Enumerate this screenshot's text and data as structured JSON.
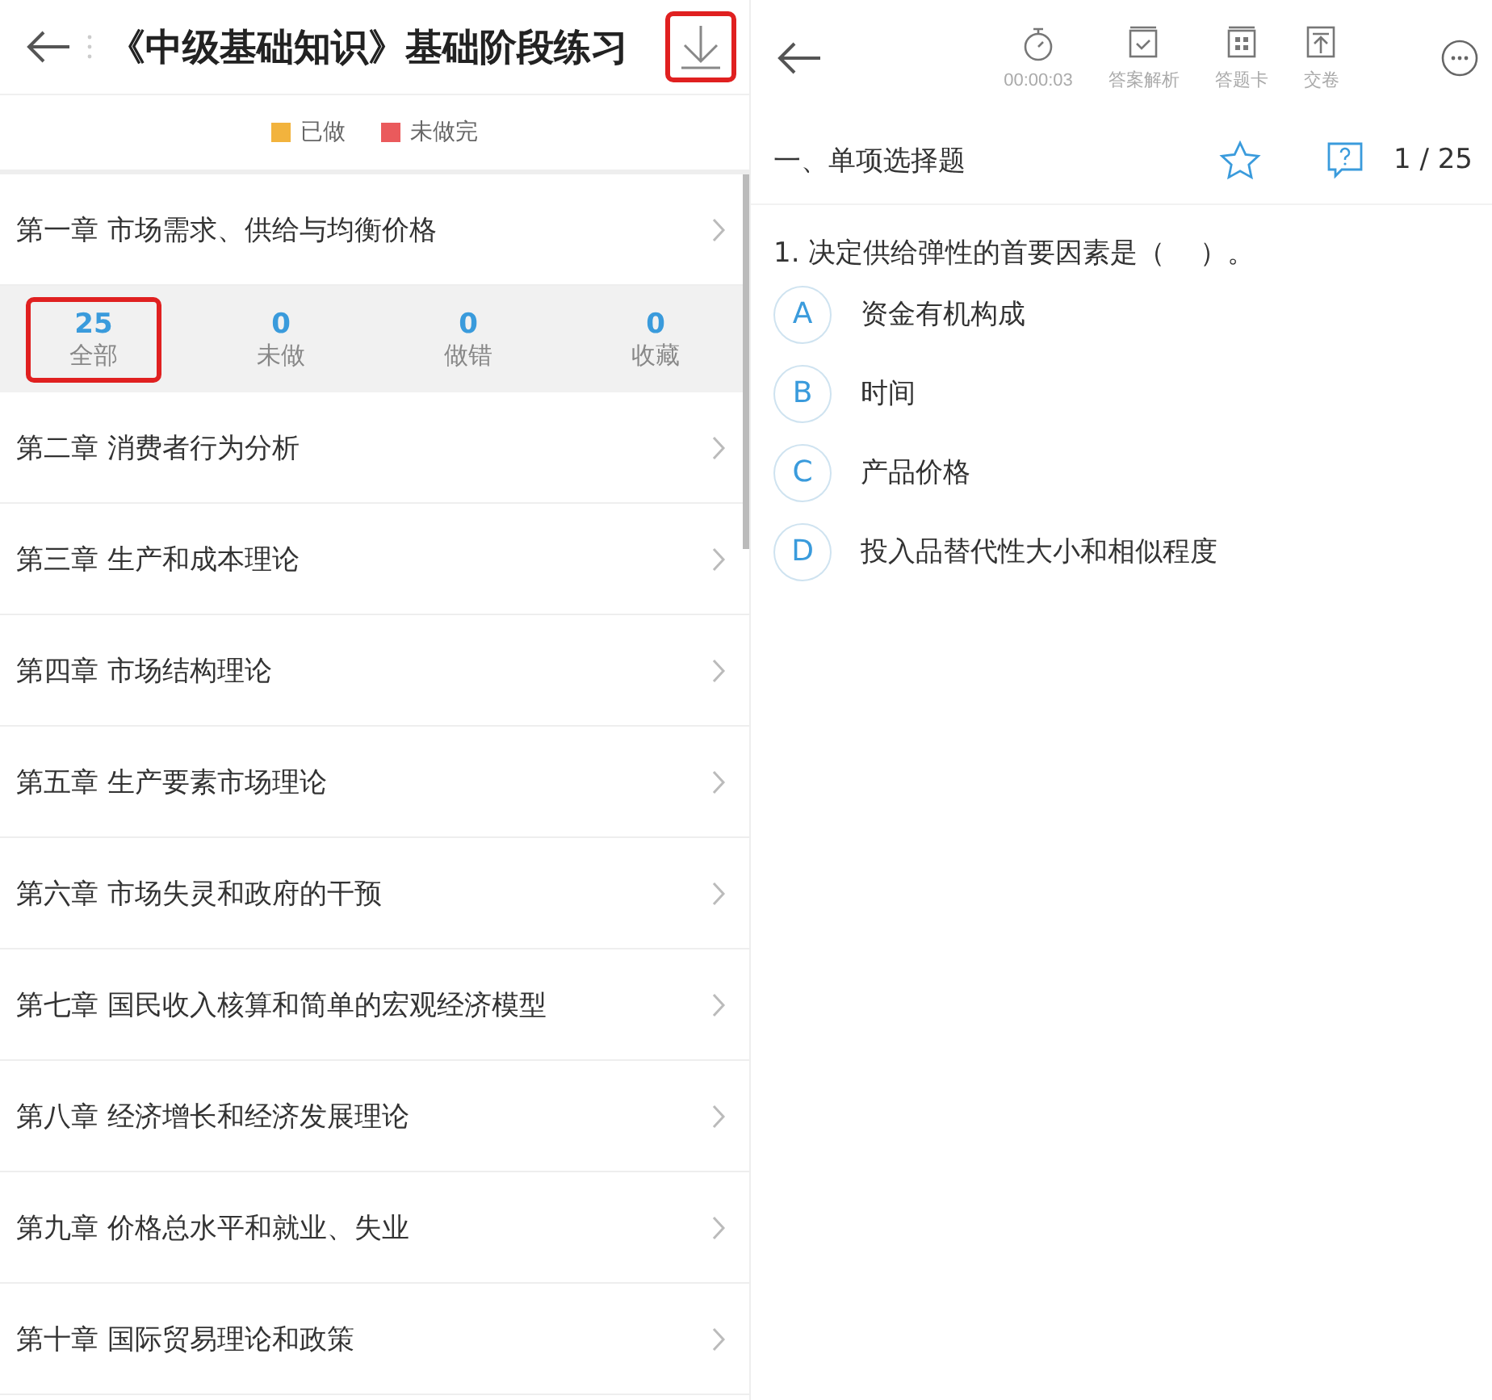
{
  "list_page": {
    "title": "《中级基础知识》基础阶段练习",
    "download_highlighted": true,
    "legend": [
      {
        "label": "已做",
        "color": "#f2b33d"
      },
      {
        "label": "未做完",
        "color": "#ea5a5c"
      }
    ],
    "chapters": [
      {
        "title": "第一章 市场需求、供给与均衡价格",
        "stats": [
          {
            "count": "25",
            "label": "全部",
            "highlighted": true
          },
          {
            "count": "0",
            "label": "未做",
            "highlighted": false
          },
          {
            "count": "0",
            "label": "做错",
            "highlighted": false
          },
          {
            "count": "0",
            "label": "收藏",
            "highlighted": false
          }
        ]
      },
      {
        "title": "第二章 消费者行为分析"
      },
      {
        "title": "第三章 生产和成本理论"
      },
      {
        "title": "第四章 市场结构理论"
      },
      {
        "title": "第五章 生产要素市场理论"
      },
      {
        "title": "第六章 市场失灵和政府的干预"
      },
      {
        "title": "第七章 国民收入核算和简单的宏观经济模型"
      },
      {
        "title": "第八章 经济增长和经济发展理论"
      },
      {
        "title": "第九章 价格总水平和就业、失业"
      },
      {
        "title": "第十章 国际贸易理论和政策"
      }
    ]
  },
  "quiz_page": {
    "toolbar": [
      {
        "kind": "timer",
        "label": "00:00:03"
      },
      {
        "kind": "analysis",
        "label": "答案解析"
      },
      {
        "kind": "card",
        "label": "答题卡"
      },
      {
        "kind": "submit",
        "label": "交卷"
      }
    ],
    "section": "一、单项选择题",
    "starred": false,
    "progress": "1 / 25",
    "question": "1. 决定供给弹性的首要因素是（    ）。",
    "options": [
      {
        "letter": "A",
        "text": "资金有机构成",
        "selected": false
      },
      {
        "letter": "B",
        "text": "时间",
        "selected": false
      },
      {
        "letter": "C",
        "text": "产品价格",
        "selected": false
      },
      {
        "letter": "D",
        "text": "投入品替代性大小和相似程度",
        "selected": false
      }
    ]
  }
}
